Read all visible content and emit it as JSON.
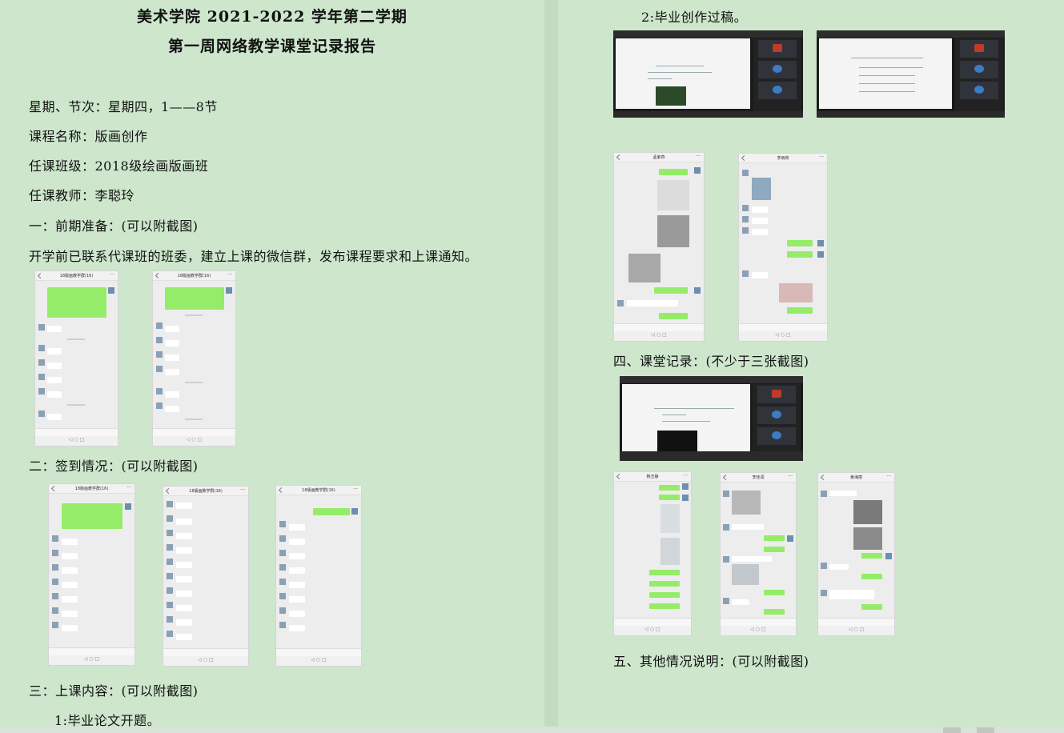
{
  "left_page": {
    "title_line1": "美术学院 2021-2022 学年第二学期",
    "title_line2": "第一周网络教学课堂记录报告",
    "fields": [
      "星期、节次：星期四，1——8节",
      "课程名称：版画创作",
      "任课班级：2018级绘画版画班",
      "任课教师：李聪玲"
    ],
    "section1_heading": "一：前期准备：(可以附截图)",
    "section1_text": "开学前已联系代课班的班委，建立上课的微信群，发布课程要求和上课通知。",
    "section2_heading": "二：签到情况：(可以附截图)",
    "section3_heading": "三：上课内容：(可以附截图)",
    "section3_item1": "1:毕业论文开题。"
  },
  "right_page": {
    "section3_item2": "2:毕业创作过稿。",
    "section4_heading": "四、课堂记录：(不少于三张截图)",
    "section5_heading": "五、其他情况说明：(可以附截图)"
  },
  "phone_titles": {
    "prep_a": "18版画教学群(16)",
    "prep_b": "18版画教学群(16)",
    "sign_a": "18版画教学群(16)",
    "sign_b": "18版画教学群(16)",
    "sign_c": "18版画教学群(16)",
    "draft_a": "孟紫燕",
    "draft_b": "李雨荷",
    "rec_a": "韩玉静",
    "rec_b": "李佳润",
    "rec_c": "姜海丽"
  },
  "colors": {
    "page_background": "#cde6cc",
    "chat_green": "#95ec69",
    "meeting_dark": "#1b1b1b"
  }
}
